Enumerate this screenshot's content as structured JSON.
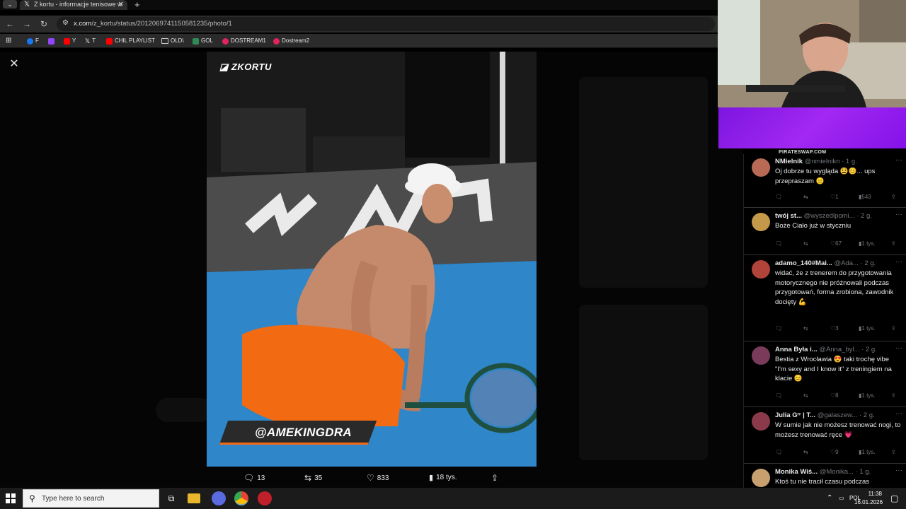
{
  "browser": {
    "tab_title": "Z kortu - informacje tenisowe w",
    "url_host": "x.com",
    "url_path": "/z_kortu/status/2012069741150581235/photo/1",
    "bookmarks": [
      {
        "label": "F",
        "color": "#1877f2"
      },
      {
        "label": "",
        "color": "#9146ff"
      },
      {
        "label": "Y",
        "color": "#ff0000"
      },
      {
        "label": "T",
        "color": "#ffffff"
      },
      {
        "label": "CHIL PLAYLIST",
        "color": "#ff0000"
      },
      {
        "label": "OLD\\",
        "color": "folder"
      },
      {
        "label": "GOL",
        "color": "#2e8b57"
      },
      {
        "label": "DOSTREAM1",
        "color": "#e0245e"
      },
      {
        "label": "Dostream2",
        "color": "#e0245e"
      }
    ]
  },
  "photo": {
    "brand": "ZKORTU",
    "handle_caption": "@AMEKINGDRA",
    "actions": {
      "replies": "13",
      "reposts": "35",
      "likes": "833",
      "views": "18 tys."
    }
  },
  "stream": {
    "banner_label": "PIRATESWAP.COM"
  },
  "replies": [
    {
      "name": "NMielnik",
      "handle": "@nmielnikn",
      "time": "· 1 g.",
      "text": "Oj dobrze tu wygląda 😫😊... ups przepraszam 😑",
      "likes": "1",
      "views": "543",
      "avatar_color": "#b86a55"
    },
    {
      "name": "twój st...",
      "handle": "@wyszedlpomi...",
      "time": "· 2 g.",
      "text": "Boże Ciało już w styczniu",
      "likes": "67",
      "views": "1 tys.",
      "avatar_color": "#c49a4a"
    },
    {
      "name": "adamo_140#Mai...",
      "handle": "@Ada...",
      "time": "· 2 g.",
      "text": "widać, że z trenerem do przygotowania motorycznego nie próżnowali podczas przygotowań, forma zrobiona, zawodnik docięty 💪",
      "likes": "3",
      "views": "1 tys.",
      "avatar_color": "#b0443a"
    },
    {
      "name": "Anna Była i...",
      "handle": "@Anna_byl...",
      "time": "· 2 g.",
      "text": "Bestia z Wrocławia 😍 taki trochę vibe \"I'm sexy and I know it\" z treningiem na klacie 😊",
      "likes": "8",
      "views": "1 tys.",
      "avatar_color": "#7a3b5b"
    },
    {
      "name": "Julia Gʳʳ | T...",
      "handle": "@galaszew...",
      "time": "· 2 g.",
      "text": "W sumie jak nie możesz trenować nogi, to możesz trenować ręce 💗",
      "likes": "9",
      "views": "1 tys.",
      "avatar_color": "#8a3a4a"
    },
    {
      "name": "Monika Wiś...",
      "handle": "@Monika...",
      "time": "· 1 g.",
      "text": "Ktoś tu nie tracił czasu podczas",
      "likes": "",
      "views": "",
      "avatar_color": "#c8a070"
    }
  ],
  "taskbar": {
    "search_placeholder": "Type here to search",
    "lang": "POL",
    "time": "11:38",
    "date": "16.01.2026"
  }
}
